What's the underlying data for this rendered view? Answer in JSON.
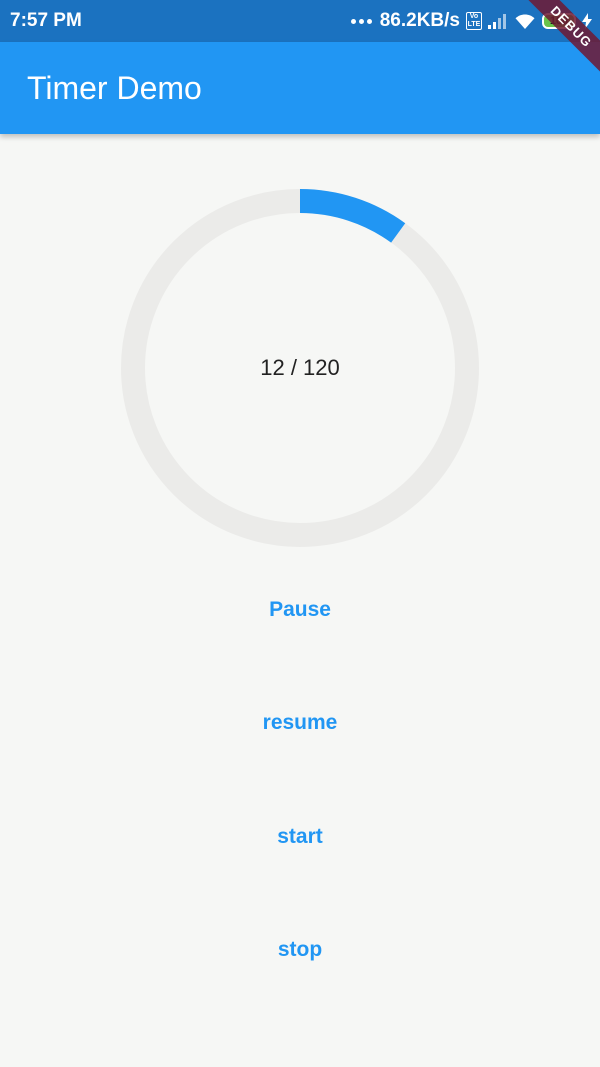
{
  "status_bar": {
    "time": "7:57 PM",
    "network_speed": "86.2KB/s",
    "volte_label": "Vo\nLTE",
    "battery_level": "100",
    "icons": [
      "signal-icon",
      "wifi-icon",
      "battery-icon",
      "charging-icon"
    ]
  },
  "app_bar": {
    "title": "Timer Demo"
  },
  "debug_banner": "DEBUG",
  "timer": {
    "elapsed": 12,
    "total": 120,
    "label": "12 / 120",
    "track_color": "#ebebe9",
    "progress_color": "#2196f3"
  },
  "buttons": {
    "pause": "Pause",
    "resume": "resume",
    "start": "start",
    "stop": "stop"
  },
  "colors": {
    "status_bar": "#1b72c0",
    "app_bar": "#2196f3",
    "background": "#f6f7f5",
    "accent": "#2196f3"
  }
}
